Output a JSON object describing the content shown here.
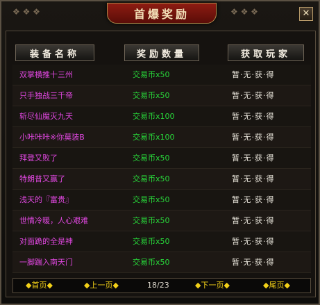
{
  "window": {
    "title": "首爆奖励",
    "close_label": "✕"
  },
  "columns": {
    "name": "装备名称",
    "reward": "奖励数量",
    "player": "获取玩家"
  },
  "rows": [
    {
      "name": "双掌横推十三州",
      "reward": "交易币x50",
      "player": "暂·无·获·得"
    },
    {
      "name": "只手独战三千帝",
      "reward": "交易币x50",
      "player": "暂·无·获·得"
    },
    {
      "name": "斩尽仙魔灭九天",
      "reward": "交易币x100",
      "player": "暂·无·获·得"
    },
    {
      "name": "小咔咔咔※你莫装B",
      "reward": "交易币x100",
      "player": "暂·无·获·得"
    },
    {
      "name": "拜登又败了",
      "reward": "交易币x50",
      "player": "暂·无·获·得"
    },
    {
      "name": "特朗普又赢了",
      "reward": "交易币x50",
      "player": "暂·无·获·得"
    },
    {
      "name": "浅天的『富贵』",
      "reward": "交易币x50",
      "player": "暂·无·获·得"
    },
    {
      "name": "世情冷暖，人心艰难",
      "reward": "交易币x50",
      "player": "暂·无·获·得"
    },
    {
      "name": "对面跪的全是神",
      "reward": "交易币x50",
      "player": "暂·无·获·得"
    },
    {
      "name": "一脚踹入南天门",
      "reward": "交易币x50",
      "player": "暂·无·获·得"
    }
  ],
  "pagination": {
    "first": "◆首页◆",
    "prev": "◆上一页◆",
    "page": "18/23",
    "next": "◆下一页◆",
    "last": "◆尾页◆"
  }
}
